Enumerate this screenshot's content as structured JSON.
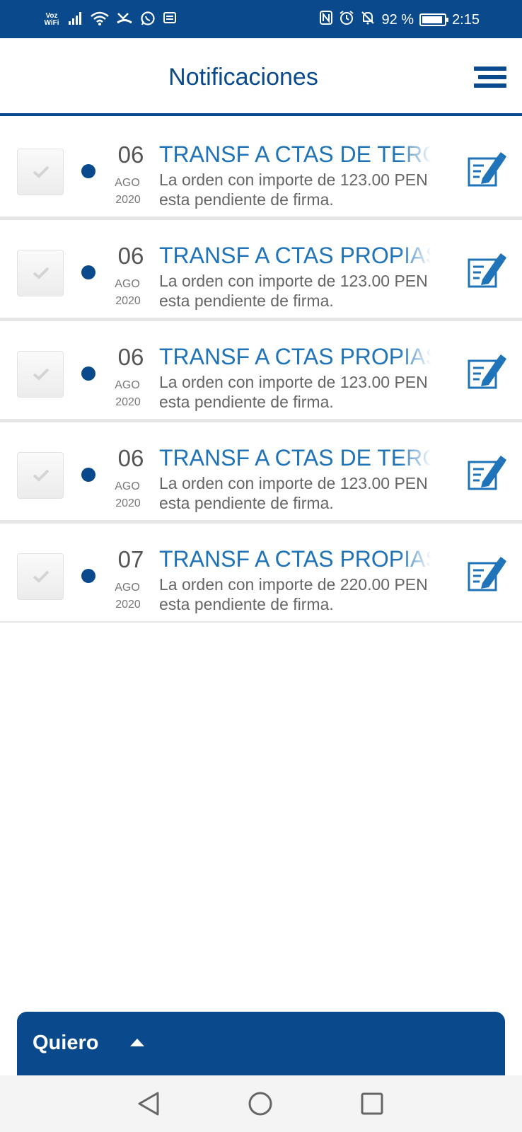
{
  "status_bar": {
    "voz": "Voz",
    "wifi": "WiFi",
    "battery_text": "92 %",
    "battery_level_percent": 92,
    "time": "2:15",
    "icons": [
      "signal-icon",
      "wifi-icon",
      "missed-call-icon",
      "whatsapp-icon",
      "message-icon",
      "nfc-icon",
      "alarm-icon",
      "mute-icon",
      "battery-icon"
    ]
  },
  "header": {
    "title": "Notificaciones",
    "menu_icon": "menu-icon"
  },
  "notifications": [
    {
      "day": "06",
      "month": "AGO",
      "year": "2020",
      "title": "TRANSF A CTAS DE TERCEROS",
      "line1": "La orden con importe de 123.00 PEN",
      "line2": "esta pendiente de firma."
    },
    {
      "day": "06",
      "month": "AGO",
      "year": "2020",
      "title": "TRANSF A CTAS PROPIAS",
      "line1": "La orden con importe de 123.00 PEN",
      "line2": "esta pendiente de firma."
    },
    {
      "day": "06",
      "month": "AGO",
      "year": "2020",
      "title": "TRANSF A CTAS PROPIAS",
      "line1": "La orden con importe de 123.00 PEN",
      "line2": "esta pendiente de firma."
    },
    {
      "day": "06",
      "month": "AGO",
      "year": "2020",
      "title": "TRANSF A CTAS DE TERCEROS",
      "line1": "La orden con importe de 123.00 PEN",
      "line2": "esta pendiente de firma."
    },
    {
      "day": "07",
      "month": "AGO",
      "year": "2020",
      "title": "TRANSF A CTAS PROPIAS",
      "line1": "La orden con importe de 220.00 PEN",
      "line2": "esta pendiente de firma."
    }
  ],
  "bottom": {
    "quiero_label": "Quiero"
  },
  "colors": {
    "primary": "#0a4a8c",
    "title_blue": "#1f73b8",
    "dot": "#0a4a8c"
  }
}
